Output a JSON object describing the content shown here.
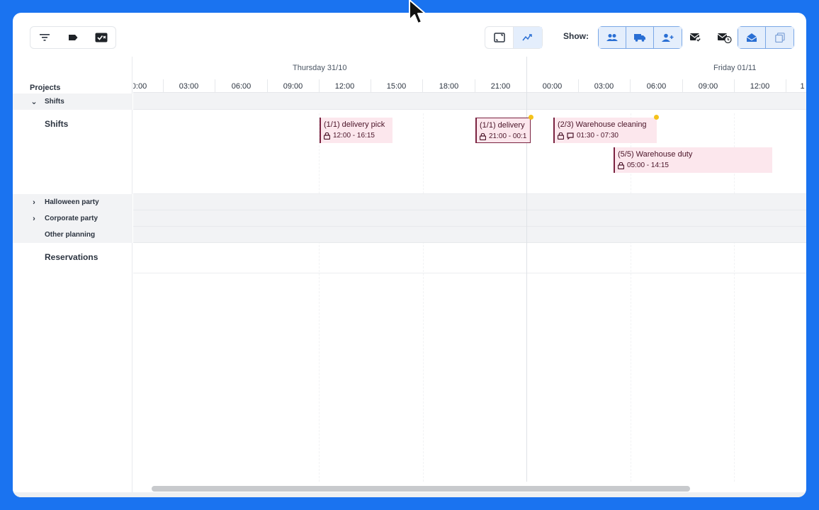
{
  "toolbar": {
    "left_icons": [
      "filter-icon",
      "tag-icon",
      "checkbox-badge-icon"
    ],
    "view_icons": [
      "fit-screen-icon",
      "trend-icon"
    ],
    "show_label": "Show:",
    "show_icons": [
      "people-icon",
      "truck-icon",
      "person-add-icon"
    ],
    "right_icons": [
      "mail-check-icon",
      "mail-clock-icon"
    ],
    "right_group_icons": [
      "mail-open-icon",
      "copy-icon"
    ],
    "accent": "#1a73f0"
  },
  "projects": {
    "title": "Projects",
    "groups": [
      {
        "label": "Shifts",
        "expanded": true
      },
      {
        "label": "Halloween party",
        "expanded": false
      },
      {
        "label": "Corporate party",
        "expanded": false
      },
      {
        "label": "Other planning"
      }
    ],
    "rows": {
      "shifts": "Shifts",
      "reservations": "Reservations"
    }
  },
  "timeline": {
    "days": [
      "Thursday 31/10",
      "Friday 01/11"
    ],
    "hours": [
      "0:00",
      "03:00",
      "06:00",
      "09:00",
      "12:00",
      "15:00",
      "18:00",
      "21:00",
      "00:00",
      "03:00",
      "06:00",
      "09:00",
      "12:00",
      "1"
    ],
    "shifts": [
      {
        "title": "(1/1) delivery pick",
        "time": "12:00 - 16:15",
        "icons": [
          "lock-icon"
        ],
        "warning": false
      },
      {
        "title": "(1/1) delivery",
        "time": "21:00 - 00:1",
        "icons": [
          "lock-icon"
        ],
        "warning": true
      },
      {
        "title": "(2/3) Warehouse cleaning",
        "time": "01:30 - 07:30",
        "icons": [
          "lock-icon",
          "comment-icon"
        ],
        "warning": true
      },
      {
        "title": "(5/5) Warehouse duty",
        "time": "05:00 - 14:15",
        "icons": [
          "lock-icon"
        ],
        "warning": false
      }
    ],
    "shift_color": "#fce7ed",
    "shift_border": "#7a2240",
    "warning_color": "#f4c21b"
  }
}
